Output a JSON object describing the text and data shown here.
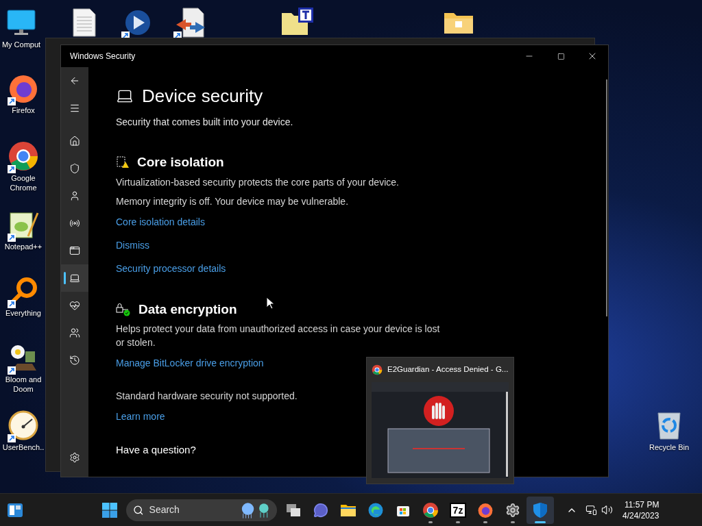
{
  "desktop_icons": [
    {
      "kind": "computer",
      "label": "My Comput",
      "shortcut": false
    },
    {
      "kind": "document",
      "shortcut": false
    },
    {
      "kind": "media",
      "shortcut": true
    },
    {
      "kind": "tool",
      "shortcut": true
    },
    {
      "kind": "folder-t",
      "shortcut": false
    },
    {
      "kind": "folder",
      "shortcut": false
    },
    {
      "kind": "firefox",
      "label": "Firefox",
      "shortcut": true
    },
    {
      "kind": "chrome",
      "label": "Google Chrome",
      "shortcut": true
    },
    {
      "kind": "notepad",
      "label": "Notepad++",
      "shortcut": true
    },
    {
      "kind": "everything",
      "label": "Everything",
      "shortcut": true
    },
    {
      "kind": "game",
      "label": "Bloom and Doom",
      "shortcut": true
    },
    {
      "kind": "gauge",
      "label": "UserBench..",
      "shortcut": true
    },
    {
      "kind": "recycle",
      "label": "Recycle Bin",
      "shortcut": false
    }
  ],
  "window": {
    "title": "Windows Security",
    "nav": [
      {
        "kind": "back",
        "selected": false
      },
      {
        "kind": "menu",
        "selected": false
      },
      {
        "kind": "home",
        "selected": false
      },
      {
        "kind": "shield",
        "selected": false
      },
      {
        "kind": "account",
        "selected": false
      },
      {
        "kind": "network",
        "selected": false
      },
      {
        "kind": "app",
        "selected": false
      },
      {
        "kind": "device",
        "selected": true
      },
      {
        "kind": "health",
        "selected": false
      },
      {
        "kind": "family",
        "selected": false
      },
      {
        "kind": "history",
        "selected": false
      },
      {
        "kind": "settings",
        "selected": false
      }
    ],
    "page_title": "Device security",
    "page_subtitle": "Security that comes built into your device.",
    "sections": [
      {
        "kind": "core",
        "heading": "Core isolation",
        "texts": [
          "Virtualization-based security protects the core parts of your device.",
          "Memory integrity is off. Your device may be vulnerable."
        ],
        "links": [
          "Core isolation details",
          "Dismiss",
          "Security processor details"
        ]
      },
      {
        "kind": "encryption",
        "heading": "Data encryption",
        "texts": [
          "Helps protect your data from unauthorized access in case your device is lost or stolen."
        ],
        "links": [
          "Manage BitLocker drive encryption"
        ]
      },
      {
        "texts": [
          "Standard hardware security not supported."
        ],
        "links": [
          "Learn more"
        ]
      }
    ],
    "footer_heading": "Have a question?"
  },
  "thumbnail": {
    "title": "E2Guardian - Access Denied - G..."
  },
  "taskbar": {
    "search": {
      "placeholder": "Search"
    },
    "apps": [
      {
        "kind": "taskview",
        "running": false,
        "selected": false
      },
      {
        "kind": "chat",
        "running": false,
        "selected": false
      },
      {
        "kind": "explorer",
        "running": false,
        "selected": false
      },
      {
        "kind": "edge",
        "running": false,
        "selected": false
      },
      {
        "kind": "store",
        "running": false,
        "selected": false
      },
      {
        "kind": "chrome",
        "running": true,
        "selected": false
      },
      {
        "kind": "archiver",
        "label": "7z",
        "running": true,
        "selected": false
      },
      {
        "kind": "firefox",
        "running": true,
        "selected": false
      },
      {
        "kind": "settings",
        "running": true,
        "selected": false
      },
      {
        "kind": "security",
        "running": true,
        "selected": true
      }
    ],
    "time": "11:57 PM",
    "date": "4/24/2023"
  }
}
